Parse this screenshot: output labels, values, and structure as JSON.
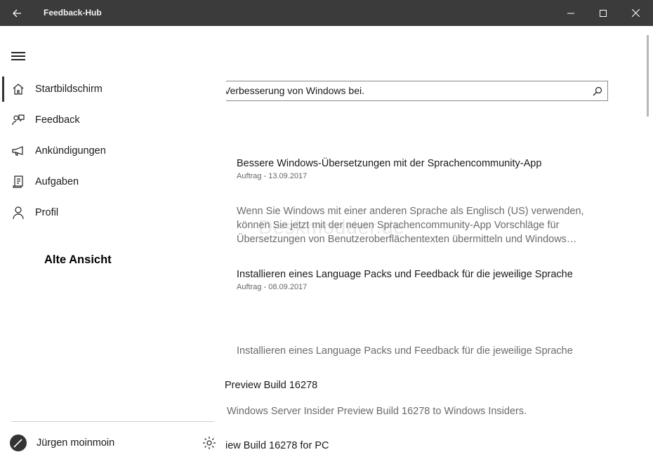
{
  "titlebar": {
    "title": "Feedback-Hub"
  },
  "nav": {
    "items": [
      {
        "label": "Startbildschirm",
        "icon": "home-icon"
      },
      {
        "label": "Feedback",
        "icon": "feedback-icon"
      },
      {
        "label": "Ankündigungen",
        "icon": "megaphone-icon"
      },
      {
        "label": "Aufgaben",
        "icon": "quests-icon"
      },
      {
        "label": "Profil",
        "icon": "person-icon"
      }
    ],
    "annotation": "Alte Ansicht",
    "user_name": "Jürgen moinmoin"
  },
  "search": {
    "value": "Verbesserung von Windows bei."
  },
  "articles": [
    {
      "title": "Bessere Windows-Übersetzungen mit der Sprachencommunity-App",
      "meta": "Auftrag  -  13.09.2017"
    },
    {
      "body": [
        "Wenn Sie Windows mit einer anderen Sprache als Englisch (US) verwenden,",
        "können Sie jetzt mit der neuen Sprachencommunity-App Vorschläge für",
        "Übersetzungen von Benutzeroberflächentexten übermitteln und Windows…"
      ]
    },
    {
      "title": "Installieren eines Language Packs und Feedback für die jeweilige Sprache",
      "meta": "Auftrag  -  08.09.2017"
    },
    {
      "body": [
        "Installieren eines Language Packs und Feedback für die jeweilige Sprache"
      ]
    },
    {
      "title": "Preview Build 16278"
    },
    {
      "body": [
        "Windows Server Insider Preview Build 16278 to Windows Insiders."
      ]
    },
    {
      "title": "iew Build 16278 for PC"
    }
  ],
  "watermark": "Deskmodder.de",
  "colors": {
    "titlebar": "#3b3b3b",
    "background": "#ffffff",
    "text": "#1a1a1a",
    "secondary": "#6b6b6b"
  }
}
